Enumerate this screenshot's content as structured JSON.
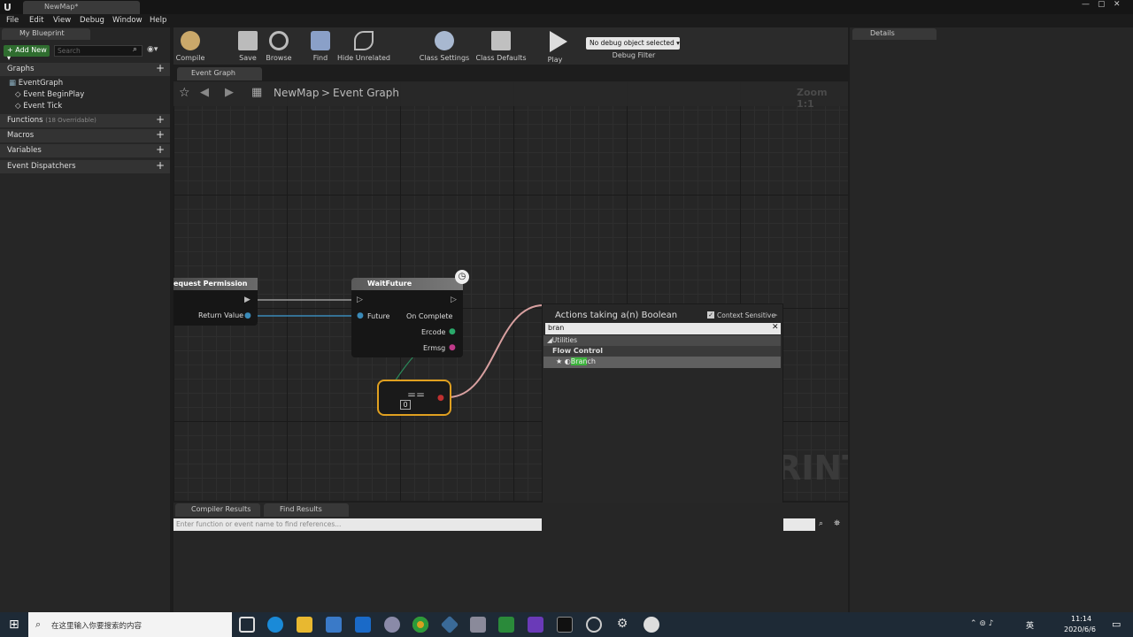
{
  "app": {
    "doc_tab": "NewMap*"
  },
  "menu": [
    "File",
    "Edit",
    "View",
    "Debug",
    "Window",
    "Help"
  ],
  "left": {
    "tab": "My Blueprint",
    "add_new": "Add New",
    "search_placeholder": "Search",
    "graphs": "Graphs",
    "event_graph": "EventGraph",
    "begin_play": "Event BeginPlay",
    "tick": "Event Tick",
    "functions": "Functions",
    "functions_note": "(18 Overridable)",
    "macros": "Macros",
    "variables": "Variables",
    "dispatchers": "Event Dispatchers"
  },
  "toolbar": {
    "compile": "Compile",
    "save": "Save",
    "browse": "Browse",
    "find": "Find",
    "hide_unrelated": "Hide Unrelated",
    "class_settings": "Class Settings",
    "class_defaults": "Class Defaults",
    "play": "Play",
    "debug_object": "No debug object selected",
    "debug_filter": "Debug Filter"
  },
  "graph": {
    "tab": "Event Graph",
    "crumb_root": "NewMap",
    "crumb_sep": ">",
    "crumb_current": "Event Graph",
    "zoom": "Zoom 1:1",
    "watermark": "RINT"
  },
  "nodes": {
    "request": {
      "title": "equest Permission",
      "return_value": "Return Value"
    },
    "wait": {
      "title": "WaitFuture",
      "future": "Future",
      "on_complete": "On Complete",
      "ercode": "Ercode",
      "ermsg": "Ermsg"
    },
    "compare": {
      "value": "0"
    }
  },
  "popup": {
    "title": "Actions taking a(n) Boolean",
    "context": "Context Sensitive",
    "query": "bran",
    "category": "Utilities",
    "subcategory": "Flow Control",
    "result_match": "Bran",
    "result_rest": "ch"
  },
  "bottom": {
    "compiler_results": "Compiler Results",
    "find_results": "Find Results",
    "find_placeholder": "Enter function or event name to find references..."
  },
  "details": {
    "tab": "Details"
  },
  "taskbar": {
    "search": "在这里输入你要搜索的内容",
    "time": "11:14",
    "date": "2020/6/6",
    "lang": "英"
  },
  "colors": {
    "exec_wire": "#d8a0a0",
    "highlight": "#3cb43c",
    "select_border": "#e0a020"
  }
}
